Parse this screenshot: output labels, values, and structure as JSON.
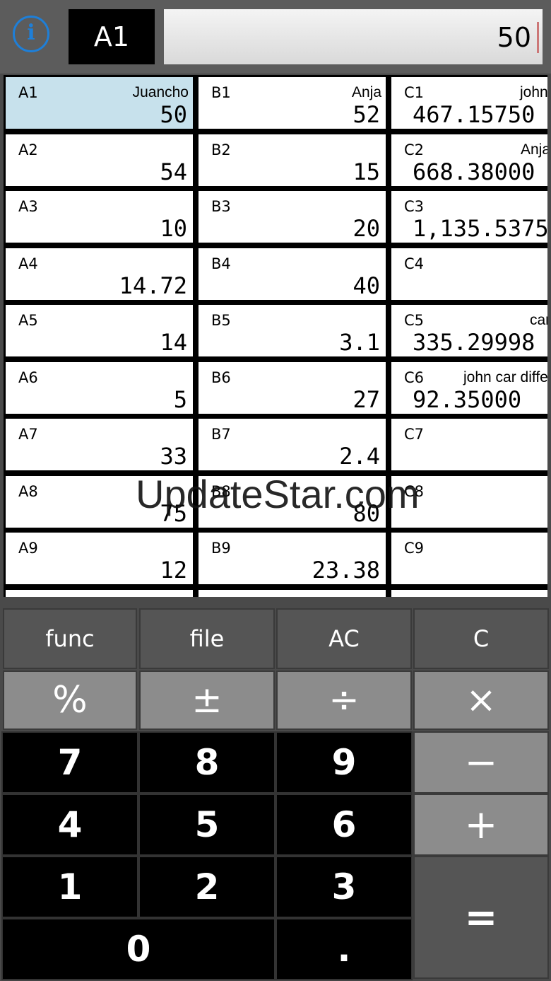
{
  "header": {
    "info_label": "i",
    "cell_reference": "A1",
    "formula_value": "50"
  },
  "grid": {
    "rows": [
      [
        {
          "ref": "A1",
          "label": "Juancho",
          "value": "50",
          "selected": true
        },
        {
          "ref": "B1",
          "label": "Anja",
          "value": "52"
        },
        {
          "ref": "C1",
          "label": "john",
          "value": "467.15750"
        }
      ],
      [
        {
          "ref": "A2",
          "label": "",
          "value": "54"
        },
        {
          "ref": "B2",
          "label": "",
          "value": "15"
        },
        {
          "ref": "C2",
          "label": "Anja",
          "value": "668.38000"
        }
      ],
      [
        {
          "ref": "A3",
          "label": "",
          "value": "10"
        },
        {
          "ref": "B3",
          "label": "",
          "value": "20"
        },
        {
          "ref": "C3",
          "label": "",
          "value": "1,135.5375"
        }
      ],
      [
        {
          "ref": "A4",
          "label": "",
          "value": "14.72"
        },
        {
          "ref": "B4",
          "label": "",
          "value": "40"
        },
        {
          "ref": "C4",
          "label": "",
          "value": ""
        }
      ],
      [
        {
          "ref": "A5",
          "label": "",
          "value": "14"
        },
        {
          "ref": "B5",
          "label": "",
          "value": "3.1"
        },
        {
          "ref": "C5",
          "label": "car",
          "value": "335.29998"
        }
      ],
      [
        {
          "ref": "A6",
          "label": "",
          "value": "5"
        },
        {
          "ref": "B6",
          "label": "",
          "value": "27"
        },
        {
          "ref": "C6",
          "label": "john car differ",
          "value": "92.35000"
        }
      ],
      [
        {
          "ref": "A7",
          "label": "",
          "value": "33"
        },
        {
          "ref": "B7",
          "label": "",
          "value": "2.4"
        },
        {
          "ref": "C7",
          "label": "",
          "value": ""
        }
      ],
      [
        {
          "ref": "A8",
          "label": "",
          "value": "75"
        },
        {
          "ref": "B8",
          "label": "",
          "value": "80"
        },
        {
          "ref": "C8",
          "label": "",
          "value": ""
        }
      ],
      [
        {
          "ref": "A9",
          "label": "",
          "value": "12"
        },
        {
          "ref": "B9",
          "label": "",
          "value": "23.38"
        },
        {
          "ref": "C9",
          "label": "",
          "value": ""
        }
      ]
    ]
  },
  "watermark": "UpdateStar.com",
  "keypad": {
    "func": "func",
    "file": "file",
    "all_clear": "AC",
    "clear": "C",
    "percent": "%",
    "plus_minus": "±",
    "divide": "÷",
    "multiply": "×",
    "seven": "7",
    "eight": "8",
    "nine": "9",
    "minus": "−",
    "four": "4",
    "five": "5",
    "six": "6",
    "plus": "+",
    "one": "1",
    "two": "2",
    "three": "3",
    "equals": "=",
    "zero": "0",
    "decimal": "."
  }
}
